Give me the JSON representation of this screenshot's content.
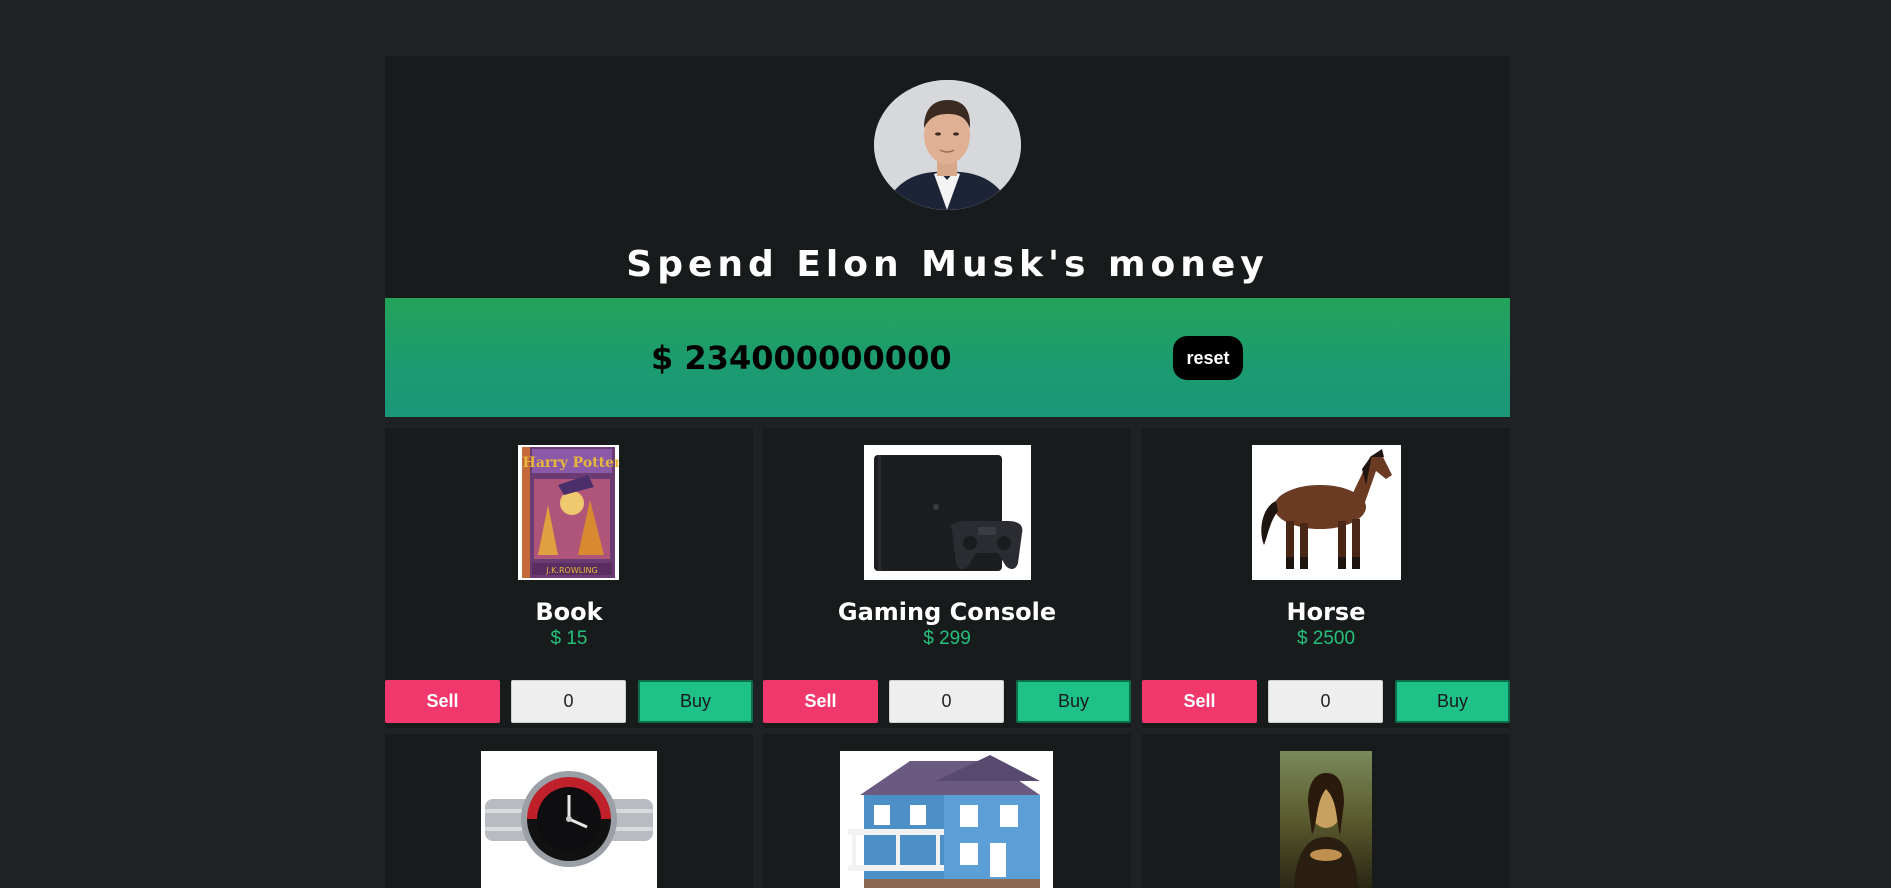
{
  "header": {
    "title": "Spend Elon Musk's money",
    "avatar_icon": "elon-musk-portrait"
  },
  "balance": {
    "amount": "$ 234000000000",
    "reset_label": "reset"
  },
  "colors": {
    "sell": "#f0386c",
    "buy": "#1ec187",
    "price": "#24c07a",
    "bar_top": "#24a35a",
    "bar_bottom": "#1a9778"
  },
  "products": [
    {
      "name": "Book",
      "price": "$ 15",
      "sell_label": "Sell",
      "buy_label": "Buy",
      "quantity": "0",
      "image_icon": "harry-potter-book"
    },
    {
      "name": "Gaming Console",
      "price": "$ 299",
      "sell_label": "Sell",
      "buy_label": "Buy",
      "quantity": "0",
      "image_icon": "playstation-console"
    },
    {
      "name": "Horse",
      "price": "$ 2500",
      "sell_label": "Sell",
      "buy_label": "Buy",
      "quantity": "0",
      "image_icon": "horse"
    },
    {
      "image_icon": "rolex-watch"
    },
    {
      "image_icon": "blue-house"
    },
    {
      "image_icon": "mona-lisa-painting"
    }
  ]
}
